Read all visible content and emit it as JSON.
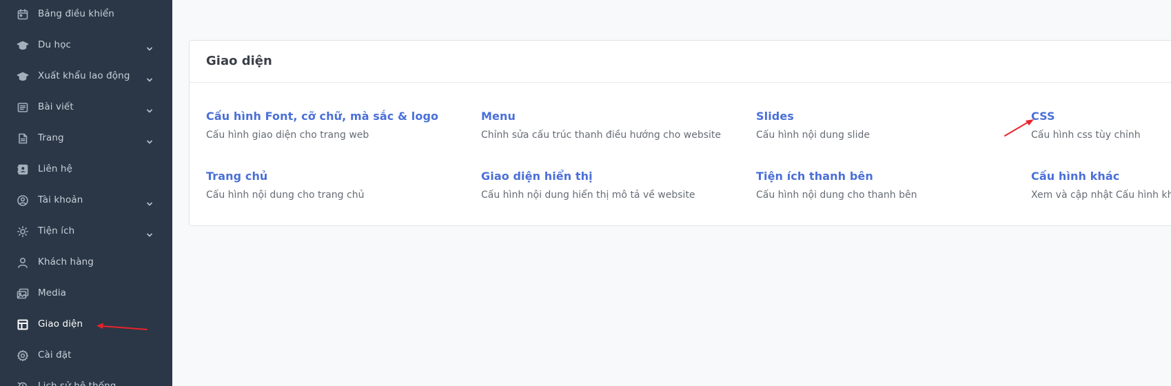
{
  "sidebar": {
    "items": [
      {
        "label": "Bảng điều khiển",
        "icon": "calendar-icon",
        "has_children": false
      },
      {
        "label": "Du học",
        "icon": "graduation-cap-icon",
        "has_children": true
      },
      {
        "label": "Xuất khẩu lao động",
        "icon": "graduation-cap-icon",
        "has_children": true
      },
      {
        "label": "Bài viết",
        "icon": "article-icon",
        "has_children": true
      },
      {
        "label": "Trang",
        "icon": "page-icon",
        "has_children": true
      },
      {
        "label": "Liên hệ",
        "icon": "contact-book-icon",
        "has_children": false
      },
      {
        "label": "Tài khoản",
        "icon": "user-circle-icon",
        "has_children": true
      },
      {
        "label": "Tiện ích",
        "icon": "sun-icon",
        "has_children": true
      },
      {
        "label": "Khách hàng",
        "icon": "user-icon",
        "has_children": false
      },
      {
        "label": "Media",
        "icon": "media-icon",
        "has_children": false
      },
      {
        "label": "Giao diện",
        "icon": "layout-icon",
        "has_children": false,
        "active": true
      },
      {
        "label": "Cài đặt",
        "icon": "gear-icon",
        "has_children": false
      },
      {
        "label": "Lịch sử hệ thống",
        "icon": "history-icon",
        "has_children": false
      }
    ]
  },
  "card": {
    "title": "Giao diện",
    "settings": [
      {
        "title": "Cấu hình Font, cỡ chữ, mà sắc & logo",
        "desc": "Cấu hình giao diện cho trang web"
      },
      {
        "title": "Menu",
        "desc": "Chỉnh sửa cấu trúc thanh điều hướng cho website"
      },
      {
        "title": "Slides",
        "desc": "Cấu hình nội dung slide"
      },
      {
        "title": "CSS",
        "desc": "Cấu hình css tùy chỉnh"
      },
      {
        "title": "Trang chủ",
        "desc": "Cấu hình nội dung cho trang chủ"
      },
      {
        "title": "Giao diện hiển thị",
        "desc": "Cấu hình nội dung hiển thị mô tả về website"
      },
      {
        "title": "Tiện ích thanh bên",
        "desc": "Cấu hình nội dung cho thanh bên"
      },
      {
        "title": "Cấu hình khác",
        "desc": "Xem và cập nhật Cấu hình khác"
      }
    ]
  },
  "colors": {
    "sidebar_bg": "#2b3746",
    "link": "#4a6fd8",
    "annotation": "#e8232b"
  }
}
